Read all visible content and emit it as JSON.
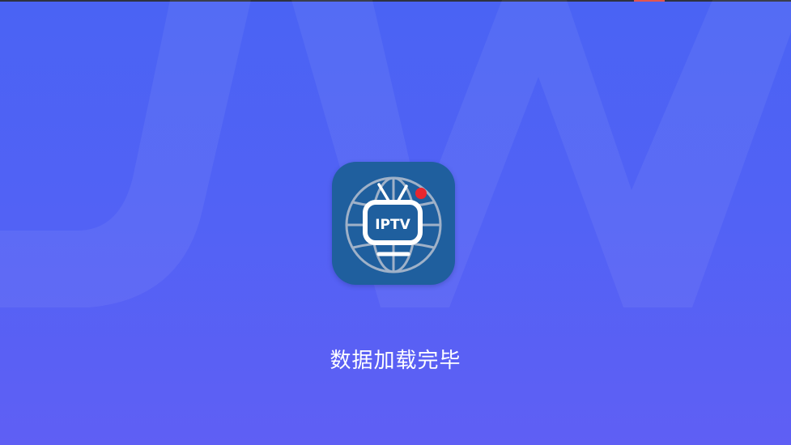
{
  "app": {
    "icon_name": "iptv-tv-globe-icon",
    "icon_text": "IPTV",
    "brand_color": "#1f5f9e",
    "badge_color": "#e8262f"
  },
  "splash": {
    "status_text": "数据加载完毕",
    "background_colors": [
      "#4a63f4",
      "#5f5ff4"
    ]
  }
}
